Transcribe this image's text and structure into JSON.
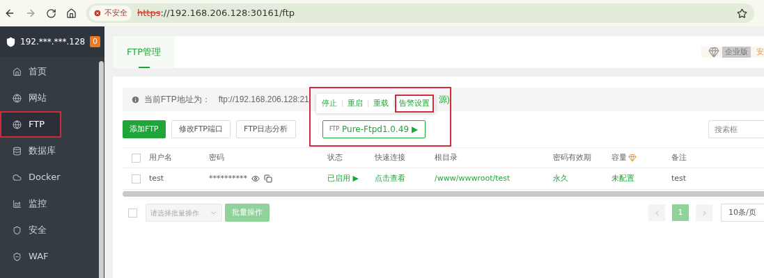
{
  "browser": {
    "security_label": "不安全",
    "url_scheme": "https",
    "url_rest": "://192.168.206.128:30161/ftp"
  },
  "sidebar": {
    "server": "192.***.***.128",
    "badge": "0",
    "items": [
      {
        "label": "首页",
        "selected": false,
        "highlighted": false
      },
      {
        "label": "网站",
        "selected": false,
        "highlighted": false
      },
      {
        "label": "FTP",
        "selected": true,
        "highlighted": true
      },
      {
        "label": "数据库",
        "selected": false,
        "highlighted": false
      },
      {
        "label": "Docker",
        "selected": false,
        "highlighted": false
      },
      {
        "label": "监控",
        "selected": false,
        "highlighted": false
      },
      {
        "label": "安全",
        "selected": false,
        "highlighted": false
      },
      {
        "label": "WAF",
        "selected": false,
        "highlighted": false
      }
    ]
  },
  "tabs": [
    {
      "label": "FTP管理",
      "selected": true
    }
  ],
  "edition": {
    "label": "企业版",
    "next": "安"
  },
  "info": {
    "prefix": "当前FTP地址为：",
    "address": "ftp://192.168.206.128:21",
    "tail": "源)"
  },
  "popup": {
    "actions": [
      {
        "label": "停止",
        "highlighted": false
      },
      {
        "label": "重启",
        "highlighted": false
      },
      {
        "label": "重载",
        "highlighted": false
      },
      {
        "label": "告警设置",
        "highlighted": true
      }
    ]
  },
  "toolbar": {
    "buttons": [
      {
        "label": "添加FTP",
        "kind": "primary"
      },
      {
        "label": "修改FTP端口",
        "kind": "plain"
      },
      {
        "label": "FTP日志分析",
        "kind": "plain"
      }
    ],
    "service": {
      "icon_text": "FTP",
      "label": "Pure-Ftpd1.0.49 ▶"
    },
    "search": {
      "placeholder": "搜索框"
    }
  },
  "table": {
    "select_all_checked": false,
    "columns": [
      "用户名",
      "密码",
      "状态",
      "快速连接",
      "根目录",
      "密码有效期",
      "容量",
      "备注"
    ],
    "rows": [
      {
        "checked": false,
        "username": "test",
        "password": "**********",
        "status": "已启用 ▶",
        "quick": "点击查看",
        "root": "/www/wwwroot/test",
        "expiry": "永久",
        "quota": "未配置",
        "note": "test"
      }
    ]
  },
  "footer": {
    "batch_checked": false,
    "batch_placeholder": "请选择批量操作",
    "batch_button": "批量操作",
    "pages": [
      {
        "label": "1",
        "selected": true
      }
    ],
    "per_page": "10条/页"
  }
}
